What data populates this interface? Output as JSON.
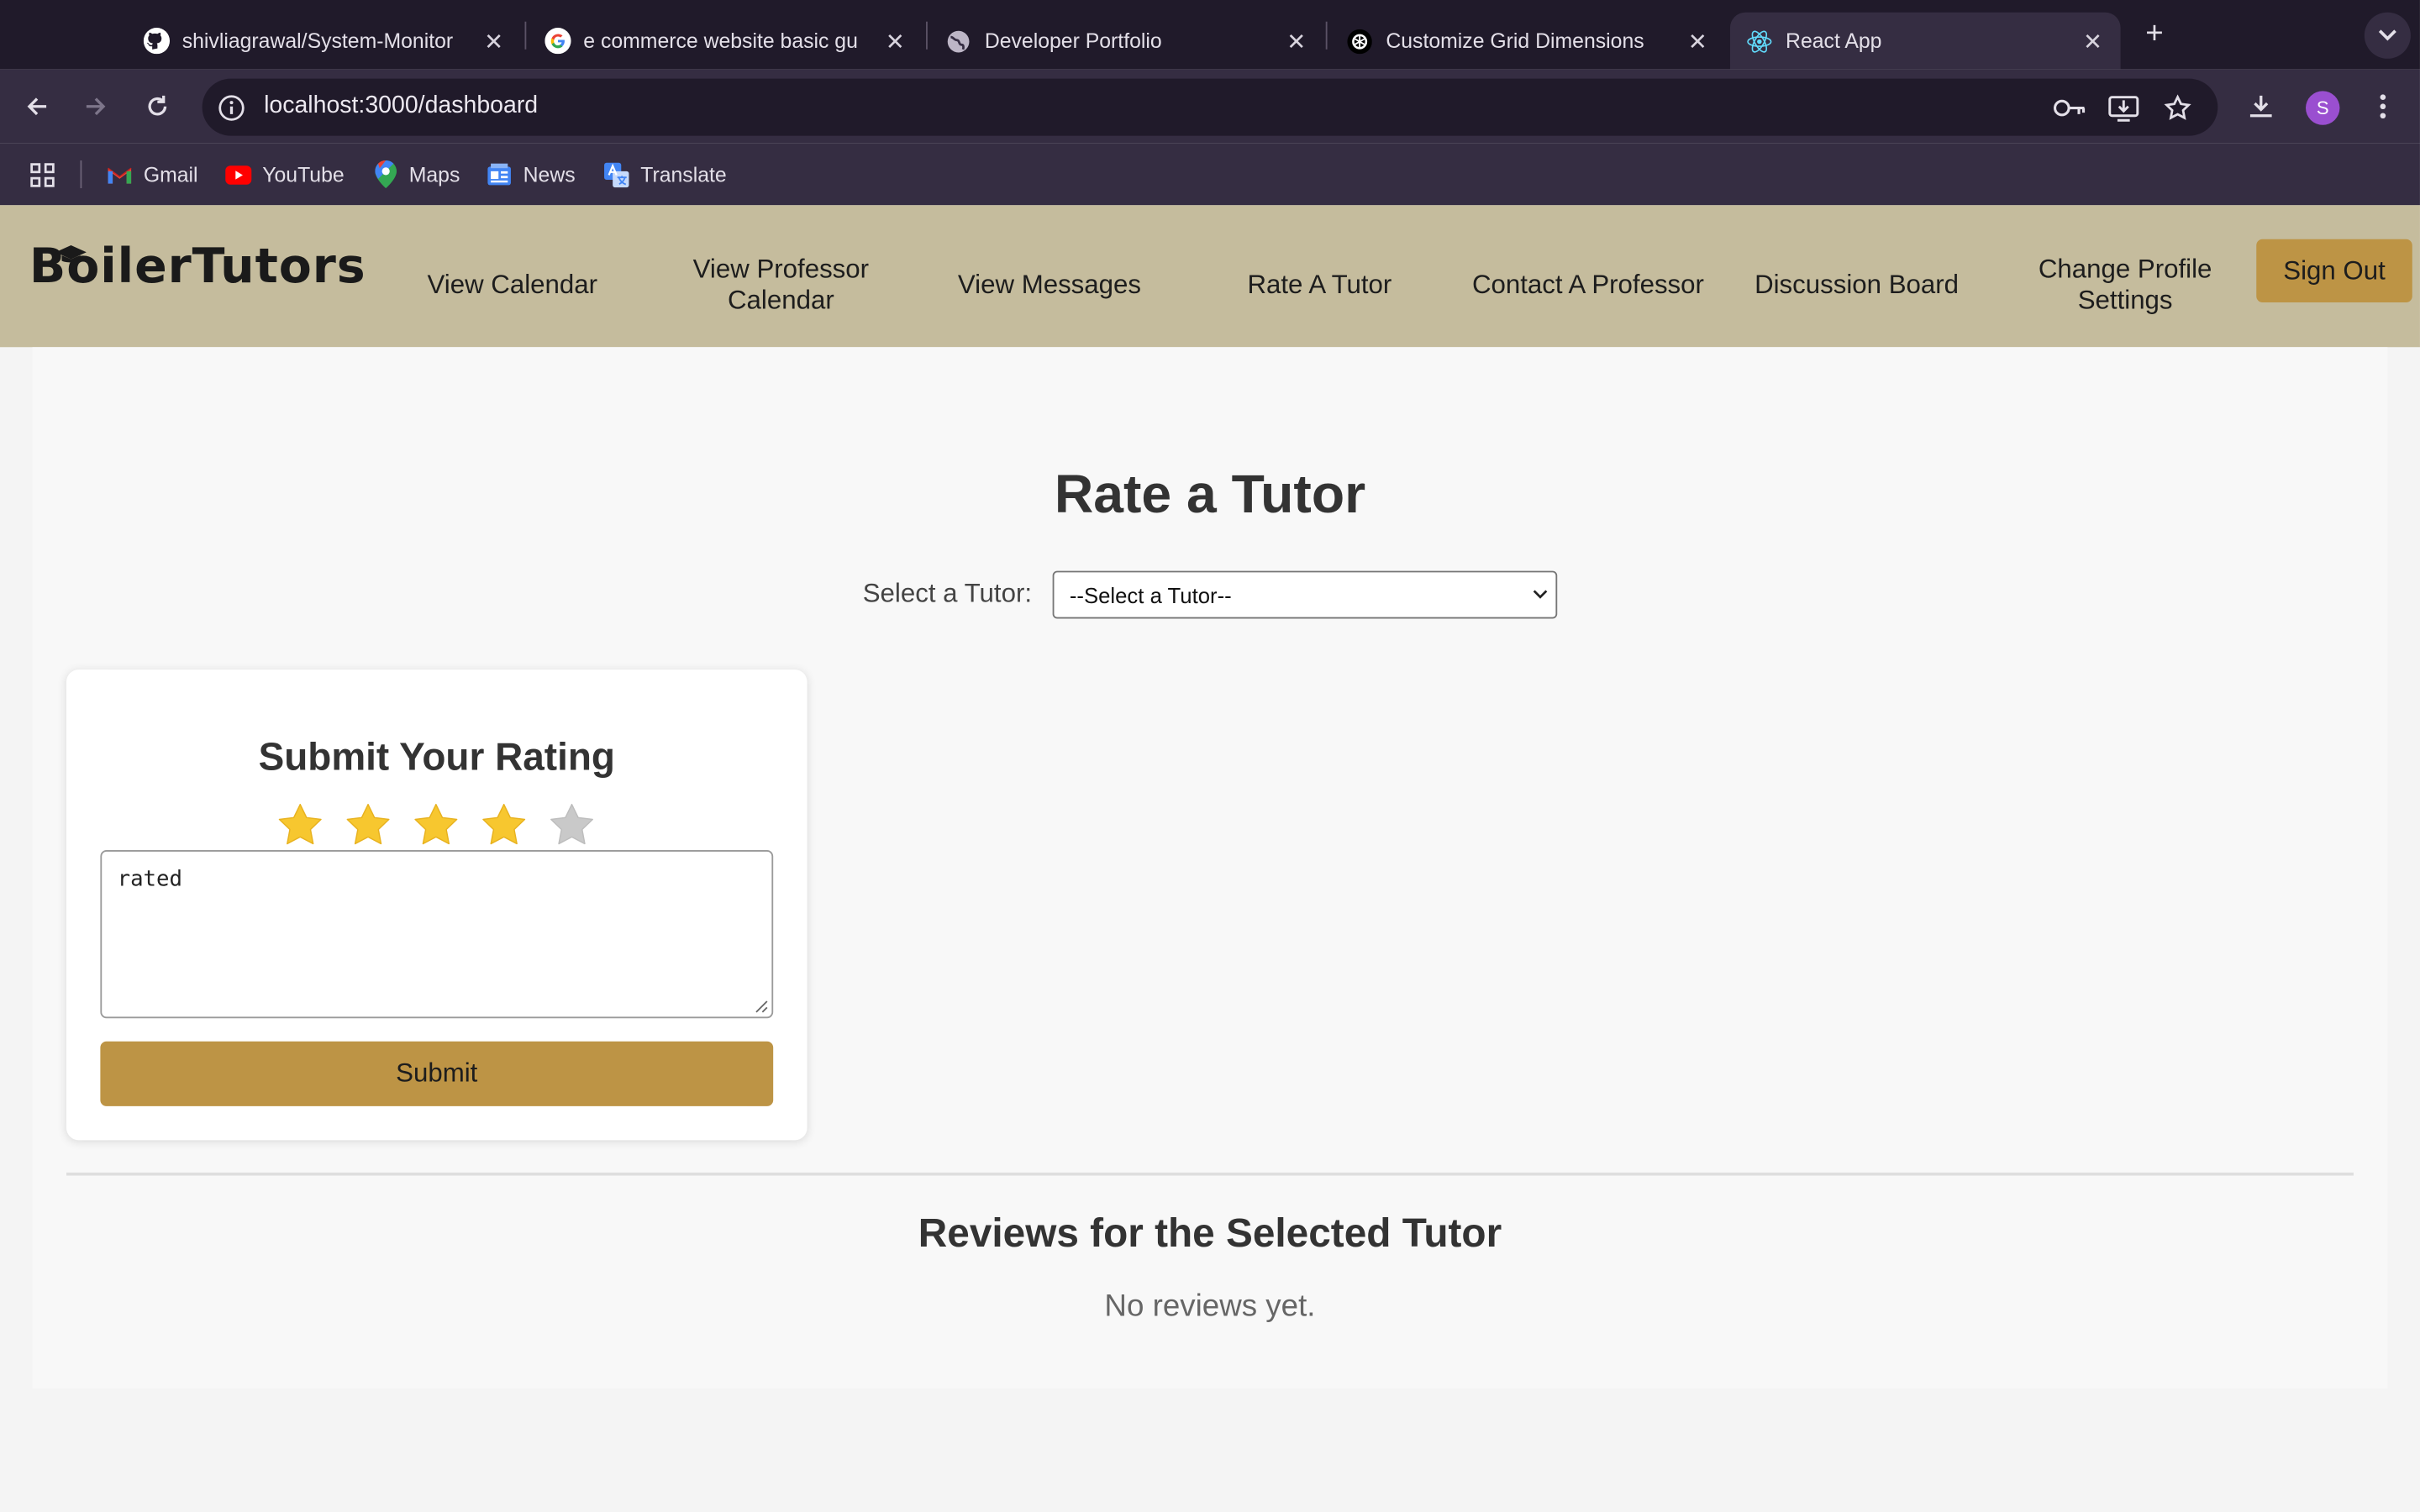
{
  "browser": {
    "tabs": [
      {
        "title": "shivliagrawal/System-Monitor",
        "favicon": "github-icon"
      },
      {
        "title": "e commerce website basic gu",
        "favicon": "google-icon"
      },
      {
        "title": "Developer Portfolio",
        "favicon": "globe-icon"
      },
      {
        "title": "Customize Grid Dimensions",
        "favicon": "chatgpt-icon"
      },
      {
        "title": "React App",
        "favicon": "react-icon",
        "active": true
      }
    ],
    "url": "localhost:3000/dashboard",
    "profile_initial": "S",
    "bookmarks": [
      {
        "label": "Gmail",
        "icon": "gmail-icon"
      },
      {
        "label": "YouTube",
        "icon": "youtube-icon"
      },
      {
        "label": "Maps",
        "icon": "maps-icon"
      },
      {
        "label": "News",
        "icon": "news-icon"
      },
      {
        "label": "Translate",
        "icon": "translate-icon"
      }
    ]
  },
  "app": {
    "brand": "BoilerTutors",
    "nav": [
      {
        "label": "View Calendar"
      },
      {
        "label": "View Professor Calendar"
      },
      {
        "label": "View Messages"
      },
      {
        "label": "Rate A Tutor"
      },
      {
        "label": "Contact A Professor"
      },
      {
        "label": "Discussion Board"
      },
      {
        "label": "Change Profile Settings"
      }
    ],
    "sign_out": "Sign Out",
    "colors": {
      "navbar": "#c5bc9d",
      "accent": "#bd9445",
      "star_on": "#f7c72f",
      "star_off": "#c9c9c9"
    }
  },
  "page": {
    "title": "Rate a Tutor",
    "select_label": "Select a Tutor:",
    "select_value": "--Select a Tutor--",
    "rating_card": {
      "title": "Submit Your Rating",
      "rating": 4,
      "max_rating": 5,
      "comment": "rated",
      "submit_label": "Submit"
    },
    "reviews_title": "Reviews for the Selected Tutor",
    "reviews_empty": "No reviews yet."
  }
}
